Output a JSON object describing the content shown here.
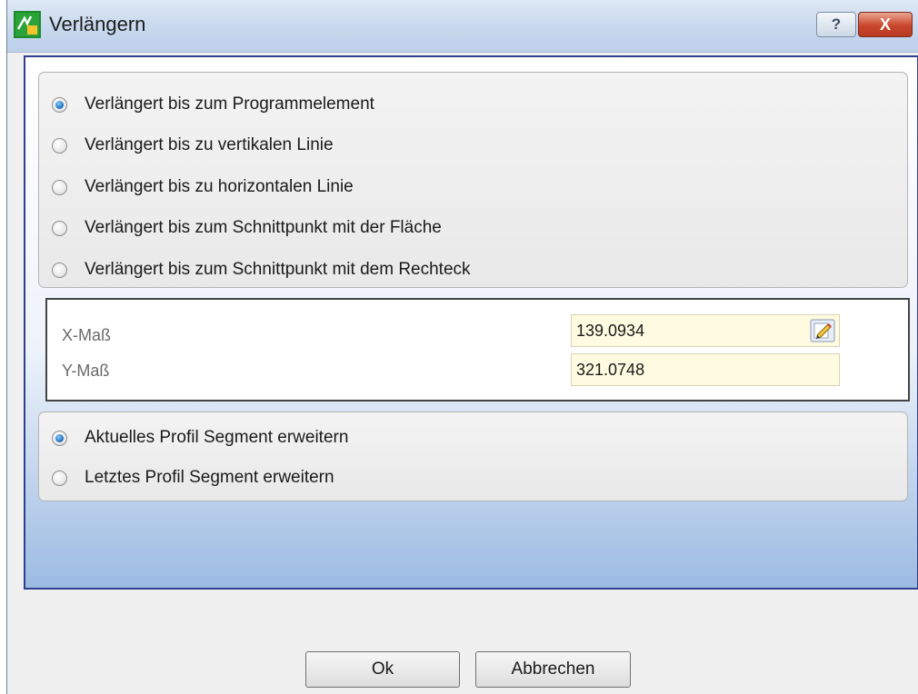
{
  "window": {
    "title": "Verlängern",
    "help_label": "?",
    "close_label": "X"
  },
  "extend_mode": {
    "selected": 0,
    "options": [
      "Verlängert bis zum Programmelement",
      "Verlängert bis zu vertikalen Linie",
      "Verlängert bis zu horizontalen Linie",
      "Verlängert bis zum Schnittpunkt mit der Fläche",
      "Verlängert bis zum Schnittpunkt mit dem Rechteck"
    ]
  },
  "dimensions": {
    "x_label": "X-Maß",
    "x_value": "139.0934",
    "y_label": "Y-Maß",
    "y_value": "321.0748"
  },
  "segment_mode": {
    "selected": 0,
    "options": [
      "Aktuelles Profil Segment erweitern",
      "Letztes Profil Segment erweitern"
    ]
  },
  "buttons": {
    "ok": "Ok",
    "cancel": "Abbrechen"
  },
  "colors": {
    "accent": "#2f3f8f",
    "input_bg": "#fffbe0",
    "close": "#c9462b"
  }
}
